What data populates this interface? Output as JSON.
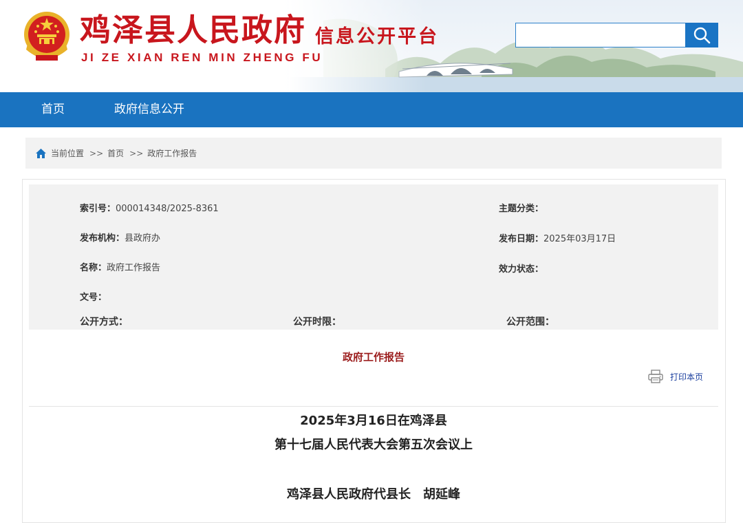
{
  "header": {
    "title": "鸡泽县人民政府",
    "pinyin": "JI ZE XIAN REN MIN ZHENG FU",
    "subtitle": "信息公开平台",
    "search": {
      "placeholder": "",
      "value": ""
    }
  },
  "nav": {
    "items": [
      "首页",
      "政府信息公开"
    ]
  },
  "breadcrumb": {
    "label": "当前位置",
    "sep": ">>",
    "items": [
      "首页",
      "政府工作报告"
    ]
  },
  "meta": {
    "index_label": "索引号：",
    "index_value": "000014348/2025-8361",
    "topic_label": "主题分类：",
    "topic_value": "",
    "agency_label": "发布机构：",
    "agency_value": "县政府办",
    "date_label": "发布日期：",
    "date_value": "2025年03月17日",
    "name_label": "名称：",
    "name_value": "政府工作报告",
    "status_label": "效力状态：",
    "status_value": "",
    "docno_label": "文号：",
    "docno_value": "",
    "mode_label": "公开方式：",
    "mode_value": "",
    "period_label": "公开时限：",
    "period_value": "",
    "scope_label": "公开范围：",
    "scope_value": ""
  },
  "document": {
    "title": "政府工作报告",
    "print_label": "打印本页",
    "lines": [
      "2025年3月16日在鸡泽县",
      "第十七届人民代表大会第五次会议上",
      "鸡泽县人民政府代县长　胡延峰"
    ]
  },
  "colors": {
    "brand_red": "#c8161d",
    "nav_blue": "#1a73c0",
    "title_maroon": "#9b1c1c",
    "print_link": "#1a3e9e"
  },
  "icons": [
    "national-emblem-icon",
    "search-icon",
    "home-icon",
    "printer-icon"
  ]
}
